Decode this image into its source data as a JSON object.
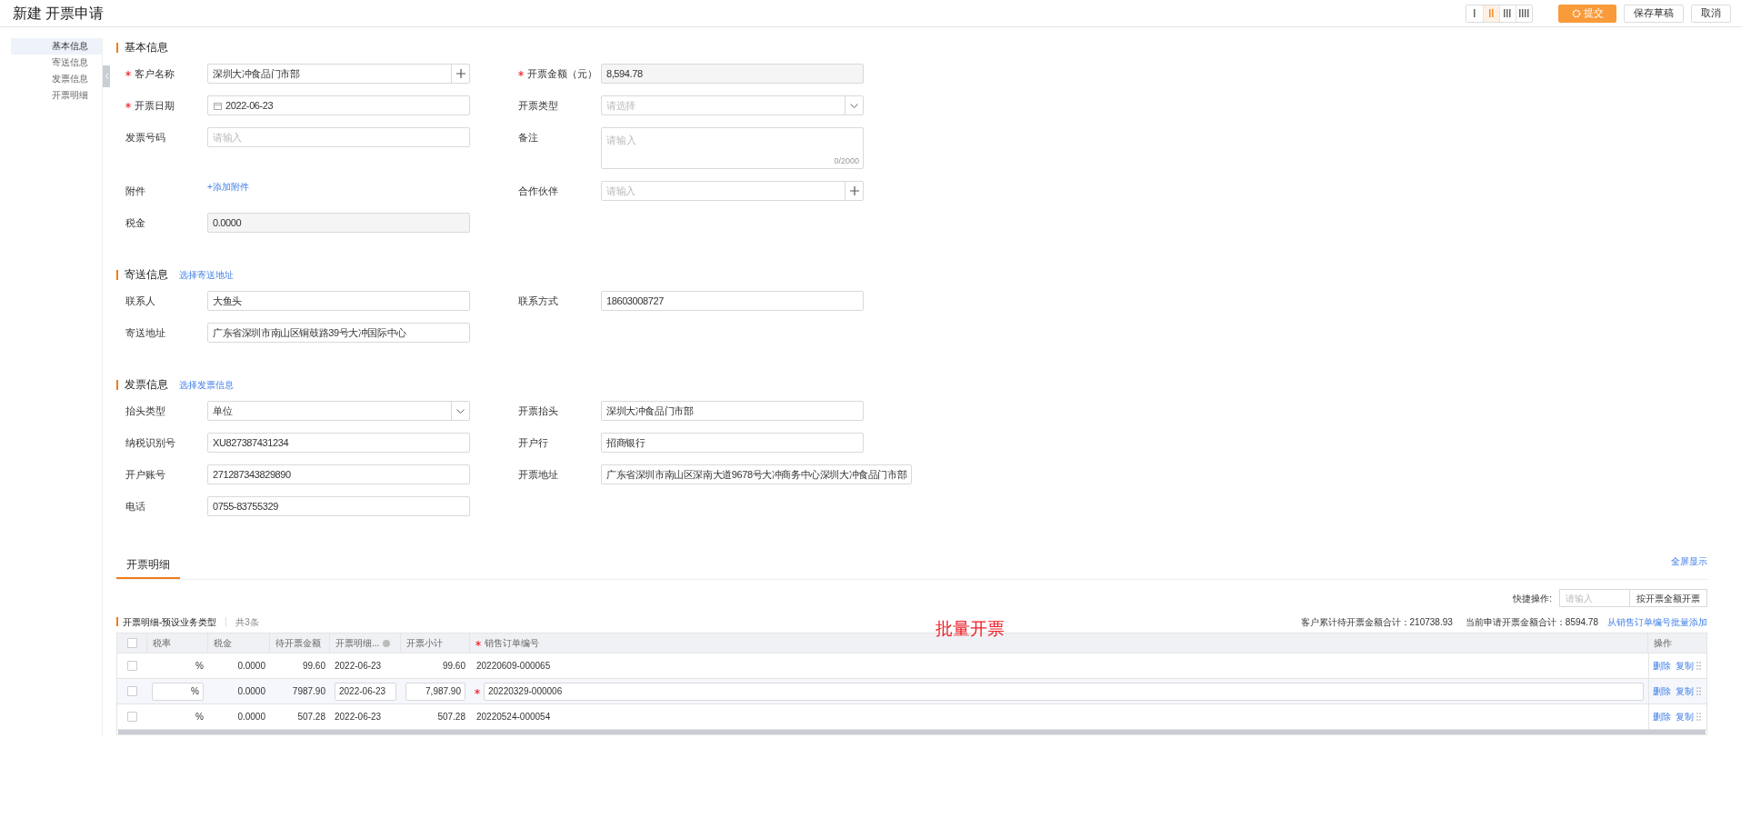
{
  "page_title": "新建 开票申请",
  "layout_buttons": [
    {
      "selected": false
    },
    {
      "selected": true
    },
    {
      "selected": false
    },
    {
      "selected": false
    }
  ],
  "actions": [
    {
      "label": "提交",
      "kind": "primary"
    },
    {
      "label": "保存草稿",
      "kind": "default"
    },
    {
      "label": "取消",
      "kind": "default"
    }
  ],
  "nav": [
    {
      "label": "基本信息",
      "selected": true
    },
    {
      "label": "寄送信息",
      "selected": false
    },
    {
      "label": "发票信息",
      "selected": false
    },
    {
      "label": "开票明细",
      "selected": false
    }
  ],
  "sections": [
    {
      "title": "基本信息",
      "rows": [
        [
          {
            "label": "客户名称",
            "required": true,
            "kind": "add",
            "value": "深圳大冲食品门市部"
          },
          {
            "label": "开票金额（元）",
            "required": true,
            "kind": "readonly",
            "value": "8,594.78"
          }
        ],
        [
          {
            "label": "开票日期",
            "required": true,
            "kind": "date",
            "value": "2022-06-23"
          },
          {
            "label": "开票类型",
            "required": false,
            "kind": "select",
            "placeholder": "请选择"
          }
        ],
        [
          {
            "label": "发票号码",
            "required": false,
            "kind": "text",
            "placeholder": "请输入"
          },
          {
            "label": "备注",
            "required": false,
            "kind": "textarea",
            "placeholder": "请输入",
            "counter": "0/2000"
          }
        ],
        [
          {
            "label": "附件",
            "required": false,
            "kind": "link",
            "value": "+添加附件"
          },
          {
            "label": "合作伙伴",
            "required": false,
            "kind": "add",
            "placeholder": "请输入"
          }
        ],
        [
          {
            "label": "税金",
            "required": false,
            "kind": "readonly",
            "value": "0.0000"
          }
        ]
      ]
    },
    {
      "title": "寄送信息",
      "link": "选择寄送地址",
      "rows": [
        [
          {
            "label": "联系人",
            "required": false,
            "kind": "text",
            "value": "大鱼头"
          },
          {
            "label": "联系方式",
            "required": false,
            "kind": "text",
            "value": "18603008727"
          }
        ],
        [
          {
            "label": "寄送地址",
            "required": false,
            "kind": "text",
            "value": "广东省深圳市南山区铜鼓路39号大冲国际中心"
          }
        ]
      ]
    },
    {
      "title": "发票信息",
      "link": "选择发票信息",
      "rows": [
        [
          {
            "label": "抬头类型",
            "required": false,
            "kind": "select",
            "value": "单位"
          },
          {
            "label": "开票抬头",
            "required": false,
            "kind": "text",
            "value": "深圳大冲食品门市部"
          }
        ],
        [
          {
            "label": "纳税识别号",
            "required": false,
            "kind": "text",
            "value": "XU827387431234"
          },
          {
            "label": "开户行",
            "required": false,
            "kind": "text",
            "value": "招商银行"
          }
        ],
        [
          {
            "label": "开户账号",
            "required": false,
            "kind": "text",
            "value": "271287343829890"
          },
          {
            "label": "开票地址",
            "required": false,
            "kind": "text",
            "value": "广东省深圳市南山区深南大道9678号大冲商务中心深圳大冲食品门市部"
          }
        ],
        [
          {
            "label": "电话",
            "required": false,
            "kind": "text",
            "value": "0755-83755329"
          }
        ]
      ]
    }
  ],
  "detail": {
    "tab": {
      "label": "开票明细",
      "selected": true
    },
    "fullscreen_link": "全屏显示",
    "quick": {
      "label": "快捷操作:",
      "placeholder": "请输入",
      "button": "按开票全额开票"
    },
    "table_title": "开票明细-预设业务类型",
    "all_checked": false,
    "count": "共3条",
    "annotation": "批量开票",
    "summary": [
      "客户累计待开票金额合计：210738.93",
      "当前申请开票金额合计：8594.78"
    ],
    "batch_link": "从销售订单编号批量添加",
    "columns": [
      {
        "label": "税率",
        "required": false,
        "help": false
      },
      {
        "label": "税金",
        "required": false,
        "help": false
      },
      {
        "label": "待开票金额",
        "required": false,
        "help": false
      },
      {
        "label": "开票明细...",
        "required": false,
        "help": true
      },
      {
        "label": "开票小计",
        "required": false,
        "help": false
      },
      {
        "label": "销售订单编号",
        "required": true,
        "help": false
      },
      {
        "label": "操作",
        "required": false,
        "help": false
      }
    ],
    "rows": [
      {
        "editing": false,
        "checked": false,
        "unit": "%",
        "tax": "0.0000",
        "pending": "99.60",
        "date": "2022-06-23",
        "subtotal": "99.60",
        "order": "20220609-000065",
        "actions": [
          "删除",
          "复制"
        ]
      },
      {
        "editing": true,
        "checked": false,
        "unit": "%",
        "tax": "0.0000",
        "pending": "7987.90",
        "date": "2022-06-23",
        "subtotal": "7,987.90",
        "order": "20220329-000006",
        "actions": [
          "删除",
          "复制"
        ]
      },
      {
        "editing": false,
        "checked": false,
        "unit": "%",
        "tax": "0.0000",
        "pending": "507.28",
        "date": "2022-06-23",
        "subtotal": "507.28",
        "order": "20220524-000054",
        "actions": [
          "删除",
          "复制"
        ]
      }
    ]
  }
}
